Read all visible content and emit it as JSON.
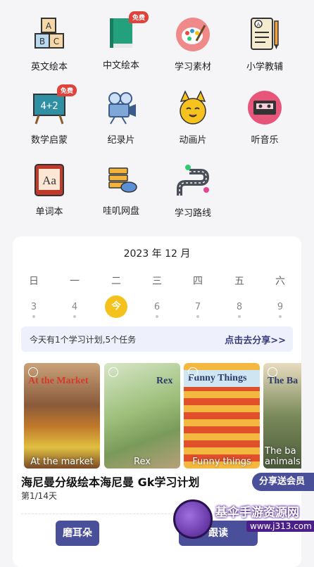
{
  "menu": [
    {
      "label": "英文绘本",
      "icon": "abc-blocks-icon"
    },
    {
      "label": "中文绘本",
      "icon": "green-book-icon",
      "badge": "免费"
    },
    {
      "label": "学习素材",
      "icon": "paint-palette-icon"
    },
    {
      "label": "小学教辅",
      "icon": "exam-paper-icon"
    },
    {
      "label": "数学启蒙",
      "icon": "math-chalkboard-icon",
      "badge": "免费"
    },
    {
      "label": "纪录片",
      "icon": "film-camera-icon"
    },
    {
      "label": "动画片",
      "icon": "cartoon-cat-icon"
    },
    {
      "label": "听音乐",
      "icon": "cassette-icon"
    },
    {
      "label": "单词本",
      "icon": "dictionary-icon"
    },
    {
      "label": "哇叽网盘",
      "icon": "cloud-drive-icon"
    },
    {
      "label": "学习路线",
      "icon": "road-map-icon"
    }
  ],
  "calendar": {
    "month_label": "2023 年 12 月",
    "weekdays": [
      "日",
      "一",
      "二",
      "三",
      "四",
      "五",
      "六"
    ],
    "days": [
      "3",
      "4",
      "今",
      "6",
      "7",
      "8",
      "9"
    ],
    "today_index": 2
  },
  "plan": {
    "text": "今天有1个学习计划,5个任务",
    "share_link": "点击去分享>>"
  },
  "books": [
    {
      "title": "At the Market",
      "caption": "At the market"
    },
    {
      "title": "Rex",
      "caption": "Rex"
    },
    {
      "title": "Funny Things",
      "caption": "Funny things"
    },
    {
      "title": "The Ba",
      "caption": "The ba animals"
    }
  ],
  "course": {
    "title": "海尼曼分级绘本海尼曼 Gk学习计划",
    "progress": "第1/14天",
    "share_button": "分享送会员"
  },
  "buttons": {
    "moerduo": "磨耳朵",
    "second": "跟读"
  },
  "watermark": {
    "name": "基伞手游资源网",
    "url": "www.j313.com"
  }
}
